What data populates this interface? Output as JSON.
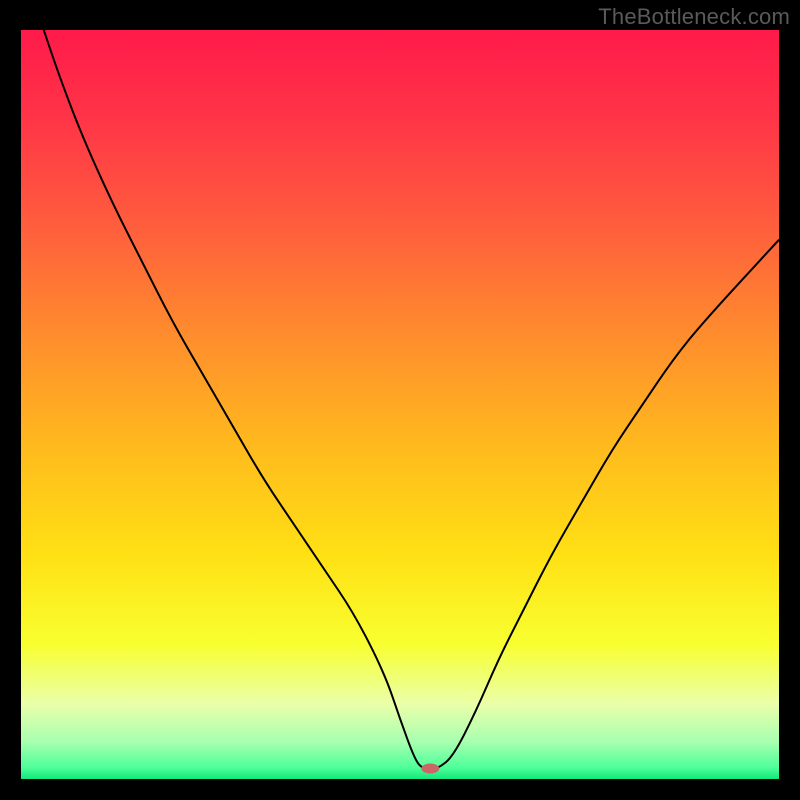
{
  "watermark": "TheBottleneck.com",
  "frame": {
    "outer_width": 800,
    "outer_height": 800,
    "border_color": "#000000",
    "border_left": 21,
    "border_right": 21,
    "border_top": 30,
    "border_bottom": 21
  },
  "chart_data": {
    "type": "line",
    "title": "",
    "xlabel": "",
    "ylabel": "",
    "xlim": [
      0,
      100
    ],
    "ylim": [
      0,
      100
    ],
    "axes_visible": false,
    "grid": false,
    "background_gradient": {
      "direction": "vertical",
      "stops": [
        {
          "offset": 0,
          "color": "#ff1a4a"
        },
        {
          "offset": 12,
          "color": "#ff3547"
        },
        {
          "offset": 25,
          "color": "#ff5a3e"
        },
        {
          "offset": 40,
          "color": "#ff8a2e"
        },
        {
          "offset": 55,
          "color": "#ffb81e"
        },
        {
          "offset": 70,
          "color": "#ffe014"
        },
        {
          "offset": 82,
          "color": "#f8ff30"
        },
        {
          "offset": 90,
          "color": "#eaffaa"
        },
        {
          "offset": 95,
          "color": "#a8ffb0"
        },
        {
          "offset": 98.5,
          "color": "#4dff99"
        },
        {
          "offset": 100,
          "color": "#12e87a"
        }
      ]
    },
    "curve": {
      "color": "#000000",
      "width": 2,
      "x": [
        3,
        5,
        8,
        12,
        16,
        20,
        24,
        28,
        32,
        36,
        40,
        44,
        48,
        50,
        52,
        53,
        54,
        55,
        57,
        60,
        63,
        66,
        70,
        74,
        78,
        82,
        86,
        90,
        100
      ],
      "y": [
        100,
        94,
        86,
        77,
        69,
        61,
        54,
        47,
        40,
        34,
        28,
        22,
        14,
        8,
        2.5,
        1.4,
        1.4,
        1.4,
        3,
        9,
        16,
        22,
        30,
        37,
        44,
        50,
        56,
        61,
        72
      ]
    },
    "flat_bottom": {
      "x_start": 53,
      "x_end": 55,
      "y": 1.4
    },
    "marker": {
      "x": 54,
      "y": 1.4,
      "color": "#cc6666",
      "rx": 9,
      "ry": 5
    }
  }
}
